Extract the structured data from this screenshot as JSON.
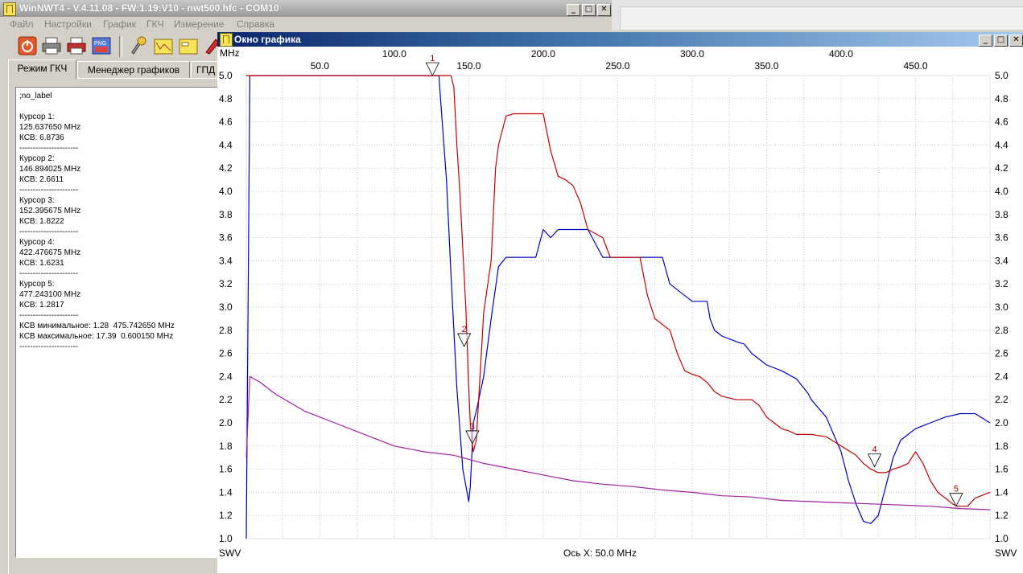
{
  "main_window": {
    "title": "WinNWT4 - V.4.11.08 - FW:1.19:V10 - nwt500.hfc - COM10",
    "menu": [
      "Файл",
      "Настройки",
      "График",
      "ГКЧ",
      "Измерение",
      "Справка"
    ],
    "tabs": [
      "Режим ГКЧ",
      "Менеджер графиков",
      "ГПД"
    ],
    "toolbar_icons": [
      "power-icon",
      "printer-icon",
      "print-pdf-icon",
      "save-png-icon",
      "settings-icon",
      "calibrate-icon",
      "folder-icon",
      "measure-icon"
    ]
  },
  "info_lines": [
    ";no_label",
    "",
    "Курсор 1:",
    "125.637650 MHz",
    "КСВ: 6.8736",
    "----------------------",
    "Курсор 2:",
    "146.894025 MHz",
    "КСВ: 2.6611",
    "----------------------",
    "Курсор 3:",
    "152.395675 MHz",
    "КСВ: 1.8222",
    "----------------------",
    "Курсор 4:",
    "422.476675 MHz",
    "КСВ: 1.6231",
    "----------------------",
    "Курсор 5:",
    "477.243100 MHz",
    "КСВ: 1.2817",
    "----------------------",
    "КСВ минимальное: 1.28  475.742650 MHz",
    "КСВ максимальное: 17.39  0.600150 MHz",
    "----------------------"
  ],
  "chart_window": {
    "title": "Окно графика",
    "x_unit": "MHz",
    "y_label_left": "SWV",
    "y_label_right": "SWV",
    "x_axis_caption": "Ось X: 50.0 MHz"
  },
  "chart_data": {
    "type": "line",
    "xlim": [
      0.6,
      500
    ],
    "ylim": [
      1.0,
      5.0
    ],
    "x_ticks": [
      {
        "value": 50,
        "label": "50.0",
        "row": "bottom"
      },
      {
        "value": 100,
        "label": "100.0",
        "row": "top"
      },
      {
        "value": 150,
        "label": "150.0",
        "row": "bottom"
      },
      {
        "value": 200,
        "label": "200.0",
        "row": "top"
      },
      {
        "value": 250,
        "label": "250.0",
        "row": "bottom"
      },
      {
        "value": 300,
        "label": "300.0",
        "row": "top"
      },
      {
        "value": 350,
        "label": "350.0",
        "row": "bottom"
      },
      {
        "value": 400,
        "label": "400.0",
        "row": "top"
      },
      {
        "value": 450,
        "label": "450.0",
        "row": "bottom"
      }
    ],
    "y_ticks": [
      "5.0",
      "4.8",
      "4.6",
      "4.4",
      "4.2",
      "4.0",
      "3.8",
      "3.6",
      "3.4",
      "3.2",
      "3.0",
      "2.8",
      "2.6",
      "2.4",
      "2.2",
      "2.0",
      "1.8",
      "1.6",
      "1.4",
      "1.2",
      "1.0"
    ],
    "grid": true,
    "series": [
      {
        "color": "#0000c0",
        "x": [
          0.6,
          3,
          100,
          130,
          131,
          135,
          138,
          142,
          146,
          150,
          151,
          152,
          153,
          155,
          160,
          165,
          170,
          175,
          180,
          185,
          190,
          195,
          200,
          205,
          210,
          215,
          220,
          225,
          230,
          240,
          250,
          260,
          270,
          275,
          278,
          280,
          285,
          300,
          310,
          312,
          315,
          320,
          330,
          335,
          340,
          350,
          360,
          370,
          375,
          378,
          380,
          390,
          400,
          405,
          410,
          415,
          420,
          425,
          430,
          435,
          440,
          445,
          450,
          460,
          470,
          480,
          490,
          500
        ],
        "y": [
          1.0,
          5.0,
          5.0,
          5.0,
          4.8,
          4.1,
          3.3,
          2.3,
          1.6,
          1.32,
          1.45,
          1.7,
          2.0,
          2.1,
          2.4,
          2.9,
          3.35,
          3.43,
          3.43,
          3.43,
          3.43,
          3.43,
          3.67,
          3.6,
          3.67,
          3.67,
          3.67,
          3.67,
          3.67,
          3.43,
          3.43,
          3.43,
          3.43,
          3.43,
          3.43,
          3.43,
          3.2,
          3.05,
          3.05,
          2.9,
          2.8,
          2.75,
          2.7,
          2.68,
          2.6,
          2.5,
          2.45,
          2.38,
          2.3,
          2.25,
          2.2,
          2.05,
          1.75,
          1.5,
          1.3,
          1.15,
          1.13,
          1.2,
          1.45,
          1.7,
          1.85,
          1.9,
          1.95,
          2.0,
          2.05,
          2.08,
          2.08,
          2.0
        ]
      },
      {
        "color": "#c00000",
        "x": [
          0.6,
          130,
          131,
          133,
          135,
          138,
          140,
          142,
          144,
          146,
          148,
          150,
          151,
          152,
          153,
          155,
          158,
          160,
          165,
          168,
          170,
          172,
          175,
          180,
          185,
          190,
          200,
          205,
          210,
          215,
          220,
          225,
          230,
          240,
          245,
          250,
          255,
          260,
          265,
          270,
          275,
          280,
          285,
          290,
          295,
          300,
          305,
          310,
          315,
          320,
          330,
          340,
          345,
          350,
          355,
          360,
          365,
          370,
          380,
          390,
          400,
          410,
          415,
          420,
          425,
          430,
          435,
          440,
          445,
          450,
          455,
          460,
          465,
          470,
          475,
          478,
          485,
          490,
          500
        ],
        "y": [
          5.0,
          5.0,
          5.0,
          5.0,
          5.0,
          5.0,
          4.9,
          4.4,
          4.0,
          3.5,
          3.0,
          2.3,
          2.0,
          1.85,
          1.75,
          1.85,
          2.5,
          2.95,
          3.4,
          4.2,
          4.4,
          4.5,
          4.65,
          4.67,
          4.67,
          4.67,
          4.67,
          4.35,
          4.13,
          4.1,
          4.05,
          3.9,
          3.67,
          3.6,
          3.43,
          3.43,
          3.43,
          3.43,
          3.43,
          3.1,
          2.9,
          2.85,
          2.8,
          2.6,
          2.45,
          2.42,
          2.4,
          2.35,
          2.27,
          2.23,
          2.2,
          2.2,
          2.15,
          2.05,
          2.0,
          1.95,
          1.93,
          1.9,
          1.9,
          1.88,
          1.8,
          1.72,
          1.65,
          1.6,
          1.57,
          1.57,
          1.6,
          1.62,
          1.65,
          1.75,
          1.65,
          1.5,
          1.4,
          1.35,
          1.3,
          1.28,
          1.28,
          1.35,
          1.4
        ]
      },
      {
        "color": "#a020a0",
        "x": [
          0.6,
          3,
          10,
          20,
          40,
          60,
          80,
          100,
          120,
          140,
          160,
          180,
          200,
          220,
          240,
          260,
          280,
          300,
          320,
          340,
          360,
          380,
          400,
          420,
          440,
          460,
          480,
          500
        ],
        "y": [
          1.7,
          2.4,
          2.35,
          2.25,
          2.1,
          2.0,
          1.9,
          1.8,
          1.75,
          1.72,
          1.65,
          1.6,
          1.55,
          1.5,
          1.47,
          1.45,
          1.42,
          1.4,
          1.37,
          1.36,
          1.33,
          1.32,
          1.31,
          1.3,
          1.29,
          1.28,
          1.26,
          1.25
        ]
      }
    ],
    "cursors": [
      {
        "label": "1",
        "x": 125.64,
        "y": 5.0
      },
      {
        "label": "2",
        "x": 146.89,
        "y": 2.66
      },
      {
        "label": "3",
        "x": 152.4,
        "y": 1.82
      },
      {
        "label": "4",
        "x": 422.48,
        "y": 1.62
      },
      {
        "label": "5",
        "x": 477.24,
        "y": 1.28
      }
    ]
  }
}
